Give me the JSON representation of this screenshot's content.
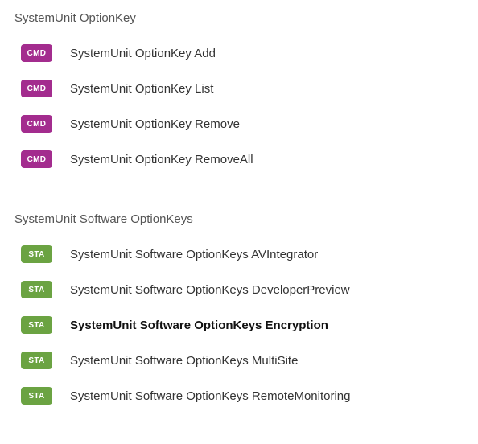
{
  "badges": {
    "cmd": "CMD",
    "sta": "STA"
  },
  "sections": [
    {
      "title": "SystemUnit OptionKey",
      "items": [
        {
          "badge": "cmd",
          "label": "SystemUnit OptionKey Add",
          "bold": false
        },
        {
          "badge": "cmd",
          "label": "SystemUnit OptionKey List",
          "bold": false
        },
        {
          "badge": "cmd",
          "label": "SystemUnit OptionKey Remove",
          "bold": false
        },
        {
          "badge": "cmd",
          "label": "SystemUnit OptionKey RemoveAll",
          "bold": false
        }
      ]
    },
    {
      "title": "SystemUnit Software OptionKeys",
      "items": [
        {
          "badge": "sta",
          "label": "SystemUnit Software OptionKeys AVIntegrator",
          "bold": false
        },
        {
          "badge": "sta",
          "label": "SystemUnit Software OptionKeys DeveloperPreview",
          "bold": false
        },
        {
          "badge": "sta",
          "label": "SystemUnit Software OptionKeys Encryption",
          "bold": true
        },
        {
          "badge": "sta",
          "label": "SystemUnit Software OptionKeys MultiSite",
          "bold": false
        },
        {
          "badge": "sta",
          "label": "SystemUnit Software OptionKeys RemoteMonitoring",
          "bold": false
        }
      ]
    }
  ]
}
